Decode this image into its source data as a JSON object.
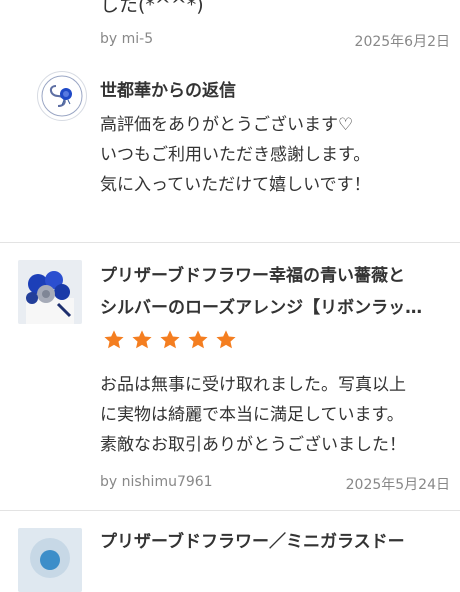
{
  "review_prev": {
    "clipped_text": "した(*^^*)",
    "user": "by mi-5",
    "date": "2025年6月2日"
  },
  "shop_reply": {
    "title": "世都華からの返信",
    "lines": [
      "高評価をありがとうございます♡",
      "いつもご利用いただき感謝します。",
      "気に入っていただけて嬉しいです！"
    ]
  },
  "review_1": {
    "product_line1": "プリザーブドフラワー幸福の青い薔薇と",
    "product_line2": "シルバーのローズアレンジ【リボンラッ…",
    "rating": 5,
    "lines": [
      "お品は無事に受け取れました。写真以上",
      "に実物は綺麗で本当に満足しています。",
      "素敵なお取引ありがとうございました！"
    ],
    "user": "by nishimu7961",
    "date": "2025年5月24日"
  },
  "review_2": {
    "product_line1": "プリザーブドフラワー／ミニガラスドー"
  },
  "colors": {
    "star": "#f47e20",
    "divider": "#e3e3e3",
    "meta": "#888888"
  }
}
